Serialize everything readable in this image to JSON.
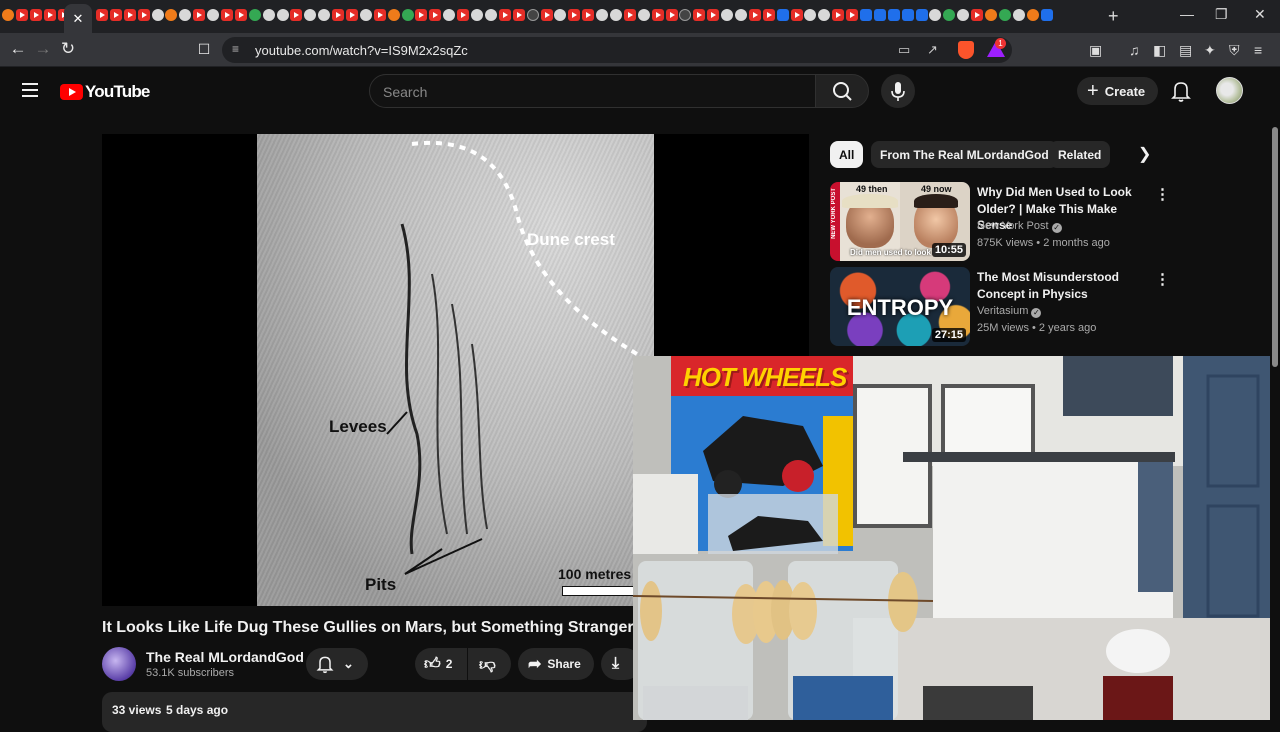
{
  "browser": {
    "active_tab_close": "✕",
    "new_tab": "+",
    "url": "youtube.com/watch?v=IS9M2x2sqZc",
    "brave_badge": "1",
    "controls": {
      "minimize": "—",
      "maximize": "❐",
      "close": "✕"
    }
  },
  "youtube": {
    "logo_text": "YouTube",
    "search_placeholder": "Search",
    "create_label": "Create"
  },
  "video": {
    "title": "It Looks Like Life Dug These Gullies on Mars, but Something Stranger Did",
    "frame_labels": {
      "dune_crest": "Dune crest",
      "levees": "Levees",
      "pits": "Pits",
      "scale": "100 metres"
    },
    "channel_name": "The Real MLordandGod",
    "subscribers": "53.1K subscribers",
    "like_count": "2",
    "share_label": "Share",
    "views": "33 views",
    "uploaded": "5 days ago"
  },
  "sidebar": {
    "chips": [
      "All",
      "From The Real MLordandGod",
      "Related"
    ],
    "recommendations": [
      {
        "title": "Why Did Men Used to Look Older? | Make This Make Sense",
        "channel": "New York Post",
        "meta": "875K views • 2 months ago",
        "duration": "10:55",
        "thumb_text_left": "49 then",
        "thumb_text_right": "49 now",
        "thumb_caption": "Did men used to look",
        "thumb_brand": "NEW YORK POST"
      },
      {
        "title": "The Most Misunderstood Concept in Physics",
        "channel": "Veritasium",
        "meta": "25M views • 2 years ago",
        "duration": "27:15",
        "thumb_text": "ENTROPY"
      }
    ]
  },
  "webcam": {
    "box_brand": "HOT WHEELS"
  },
  "colors": {
    "yt_red": "#ff0000",
    "background": "#0f0f0f",
    "surface": "#272727"
  }
}
